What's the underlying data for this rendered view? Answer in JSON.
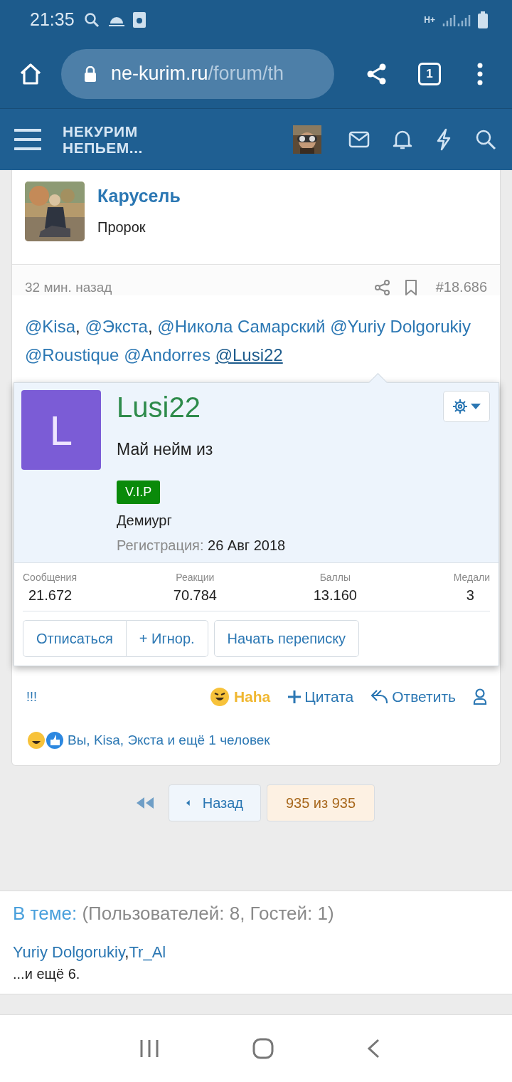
{
  "status_bar": {
    "time": "21:35",
    "network": "H+"
  },
  "browser": {
    "url_host": "ne-kurim.ru",
    "url_path": "/forum/th",
    "tab_count": "1"
  },
  "forum_header": {
    "logo_lines": [
      "НЕКУРИМ",
      "НЕПЬЕМ..."
    ]
  },
  "post": {
    "author": "Карусель",
    "author_title": "Пророк",
    "time": "32 мин. назад",
    "number": "#18.686",
    "mentions": [
      {
        "text": "@Kisa",
        "sep": ",",
        "hovered": false
      },
      {
        "text": "@Экста",
        "sep": ",",
        "hovered": false
      },
      {
        "text": "@Никола Самарский",
        "hovered": false
      },
      {
        "text": "@Yuriy Dolgorukiy",
        "hovered": false
      },
      {
        "text": "@Roustique",
        "hovered": false
      },
      {
        "text": "@Andorres",
        "hovered": false
      },
      {
        "text": "@Lusi22",
        "hovered": true
      }
    ],
    "actions_left": "!!!",
    "actions": [
      {
        "kind": "reaction",
        "label": "Haha"
      },
      {
        "kind": "quote",
        "label": "Цитата"
      },
      {
        "kind": "reply",
        "label": "Ответить"
      },
      {
        "kind": "user"
      }
    ],
    "reactions_summary": "Вы, Kisa, Экста и ещё 1 человек"
  },
  "user_card": {
    "avatar_letter": "L",
    "name": "Lusi22",
    "status": "Май нейм из",
    "badge": "V.I.P",
    "rank": "Демиург",
    "registration_label": "Регистрация:",
    "registration_date": "26 Авг 2018",
    "stats": [
      {
        "label": "Сообщения",
        "value": "21.672"
      },
      {
        "label": "Реакции",
        "value": "70.784"
      },
      {
        "label": "Баллы",
        "value": "13.160"
      },
      {
        "label": "Медали",
        "value": "3"
      }
    ],
    "buttons": [
      "Отписаться",
      "+ Игнор.",
      "Начать переписку"
    ]
  },
  "pagination": {
    "back": "Назад",
    "page": "935 из 935"
  },
  "online": {
    "title": "В теме:",
    "counts": "(Пользователей: 8, Гостей: 1)",
    "users": [
      "Yuriy Dolgorukiy",
      "Tr_Al"
    ],
    "separator": ",",
    "more": "...и ещё 6."
  }
}
